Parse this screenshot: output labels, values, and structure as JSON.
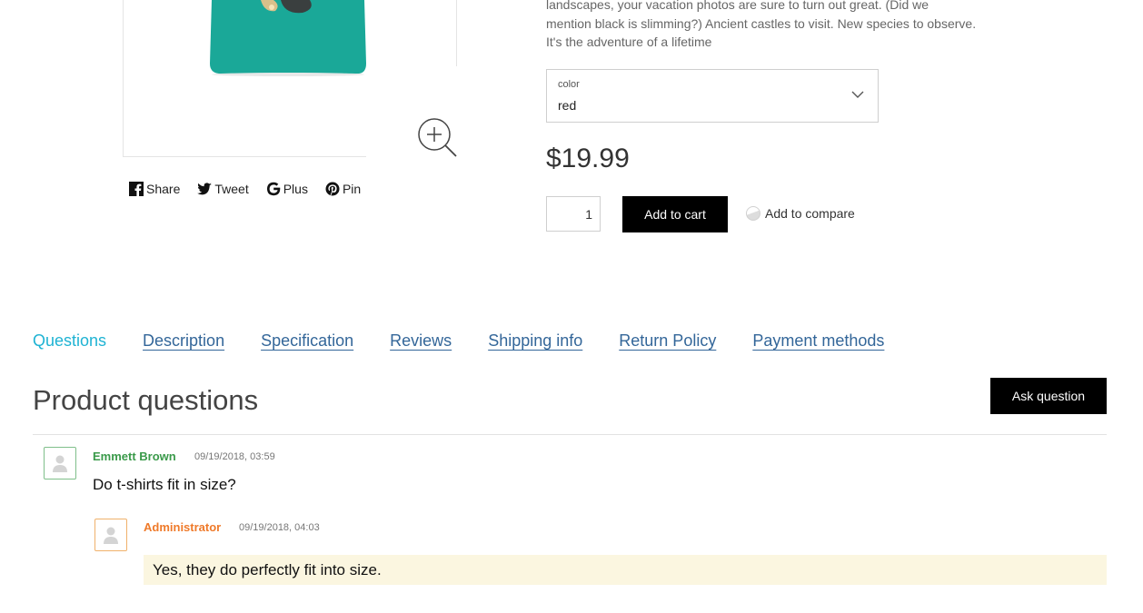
{
  "product": {
    "description_lines": [
      "landscapes, your vacation photos are sure to turn out great. (Did we",
      "mention black is slimming?) Ancient castles to visit. New species to observe.",
      "It's the adventure of a lifetime"
    ],
    "color_label": "color",
    "color_value": "red",
    "price": "$19.99",
    "quantity": "1",
    "add_to_cart_label": "Add to cart",
    "add_to_compare_label": "Add to compare"
  },
  "share": {
    "items": [
      {
        "label": "Share",
        "icon": "facebook-icon"
      },
      {
        "label": "Tweet",
        "icon": "twitter-icon"
      },
      {
        "label": "Plus",
        "icon": "google-icon"
      },
      {
        "label": "Pin",
        "icon": "pinterest-icon"
      }
    ]
  },
  "tabs": [
    {
      "label": "Questions",
      "active": true
    },
    {
      "label": "Description",
      "active": false
    },
    {
      "label": "Specification",
      "active": false
    },
    {
      "label": "Reviews",
      "active": false
    },
    {
      "label": "Shipping info",
      "active": false
    },
    {
      "label": "Return Policy",
      "active": false
    },
    {
      "label": "Payment methods",
      "active": false
    }
  ],
  "questions_section": {
    "title": "Product questions",
    "ask_button_label": "Ask question",
    "question": {
      "author": "Emmett Brown",
      "date": "09/19/2018, 03:59",
      "text": "Do t-shirts fit in size?"
    },
    "answer": {
      "author": "Administrator",
      "date": "09/19/2018, 04:03",
      "text": "Yes, they do perfectly fit into size."
    }
  },
  "colors": {
    "accent": "#1fb3d3",
    "link": "#336699",
    "shirt": "#1aa898",
    "question_author": "#3a9a4a",
    "answer_author": "#ef7a2a",
    "answer_bg": "#fbf6e0",
    "button": "#000000"
  }
}
